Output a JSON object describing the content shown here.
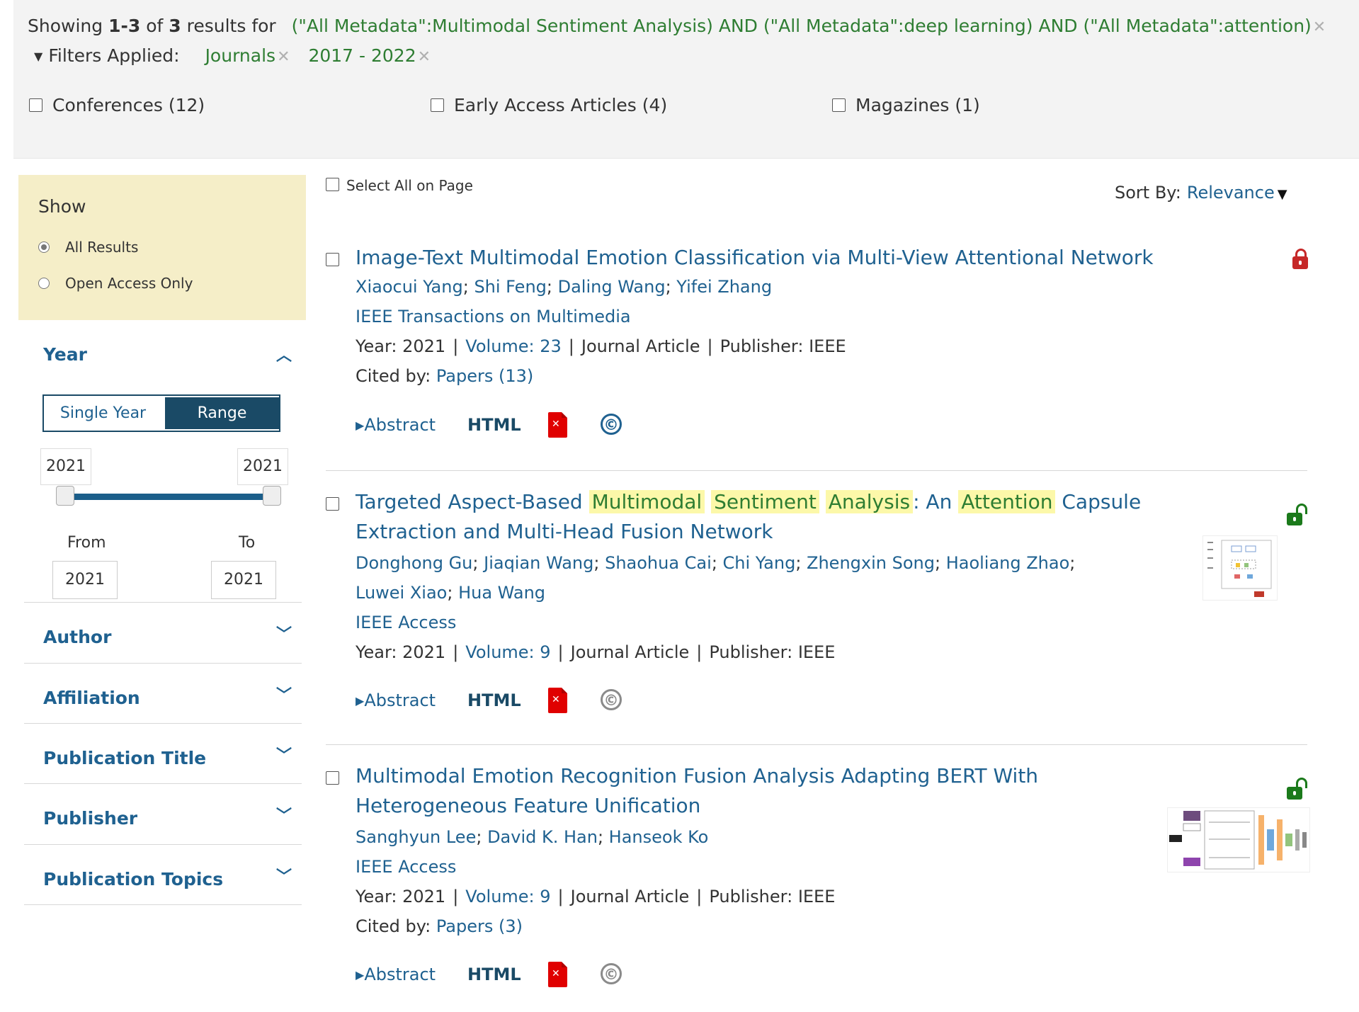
{
  "header": {
    "showing_prefix": "Showing",
    "range": "1-3",
    "of_word": "of",
    "total": "3",
    "results_for": "results for",
    "query": "(\"All Metadata\":Multimodal Sentiment Analysis) AND (\"All Metadata\":deep learning) AND (\"All Metadata\":attention)",
    "filters_label": "Filters Applied:",
    "applied_filters": [
      "Journals",
      "2017 - 2022"
    ],
    "content_types": [
      "Conferences (12)",
      "Early Access Articles (4)",
      "Magazines (1)"
    ]
  },
  "sidebar": {
    "show_title": "Show",
    "show_options": [
      "All Results",
      "Open Access Only"
    ],
    "show_selected": "All Results",
    "year_title": "Year",
    "year_modes": [
      "Single Year",
      "Range"
    ],
    "year_mode_selected": "Range",
    "slider_min_label": "2021",
    "slider_max_label": "2021",
    "from_label": "From",
    "to_label": "To",
    "from_value": "2021",
    "to_value": "2021",
    "facets": [
      "Author",
      "Affiliation",
      "Publication Title",
      "Publisher",
      "Publication Topics"
    ]
  },
  "toolbar": {
    "select_all": "Select All on Page",
    "sort_label": "Sort By:",
    "sort_value": "Relevance"
  },
  "results": [
    {
      "title_plain": "Image-Text Multimodal Emotion Classification via Multi-View Attentional Network",
      "authors": [
        "Xiaocui Yang",
        "Shi Feng",
        "Daling Wang",
        "Yifei Zhang"
      ],
      "publication": "IEEE Transactions on Multimedia",
      "year_label": "Year: 2021",
      "volume": "Volume: 23",
      "type": "Journal Article",
      "publisher": "Publisher:  IEEE",
      "cited_label": "Cited by:",
      "cited_link": "Papers (13)",
      "access": "locked"
    },
    {
      "title_parts": [
        "Targeted Aspect-Based ",
        "Multimodal",
        " ",
        "Sentiment",
        " ",
        "Analysis",
        ": An ",
        "Attention",
        " Capsule Extraction and Multi-Head Fusion Network"
      ],
      "authors_line1": [
        "Donghong Gu",
        "Jiaqian Wang",
        "Shaohua Cai",
        "Chi Yang",
        "Zhengxin Song",
        "Haoliang Zhao"
      ],
      "authors_line2": [
        "Luwei Xiao",
        "Hua Wang"
      ],
      "publication": "IEEE Access",
      "year_label": "Year: 2021",
      "volume": "Volume: 9",
      "type": "Journal Article",
      "publisher": "Publisher:  IEEE",
      "access": "open"
    },
    {
      "title_plain": "Multimodal Emotion Recognition Fusion Analysis Adapting BERT With Heterogeneous Feature Unification",
      "authors": [
        "Sanghyun Lee",
        "David K. Han",
        "Hanseok Ko"
      ],
      "publication": "IEEE Access",
      "year_label": "Year: 2021",
      "volume": "Volume: 9",
      "type": "Journal Article",
      "publisher": "Publisher:  IEEE",
      "cited_label": "Cited by:",
      "cited_link": "Papers (3)",
      "access": "open"
    }
  ],
  "actions": {
    "abstract": "Abstract",
    "html": "HTML",
    "copyright_glyph": "©"
  },
  "colors": {
    "link": "#1f6190",
    "query_green": "#2e7d32",
    "highlight": "#fcf8a9",
    "show_panel": "#f5eec8",
    "range_active": "#1a4a66",
    "lock_closed": "#c62828",
    "lock_open": "#1b7a1b",
    "pdf_red": "#e00000"
  },
  "icons": [
    "close-icon",
    "triangle-down-icon",
    "chevron-up-icon",
    "chevron-down-icon",
    "lock-icon",
    "unlock-icon",
    "pdf-icon",
    "copyright-icon",
    "caret-right-icon"
  ]
}
